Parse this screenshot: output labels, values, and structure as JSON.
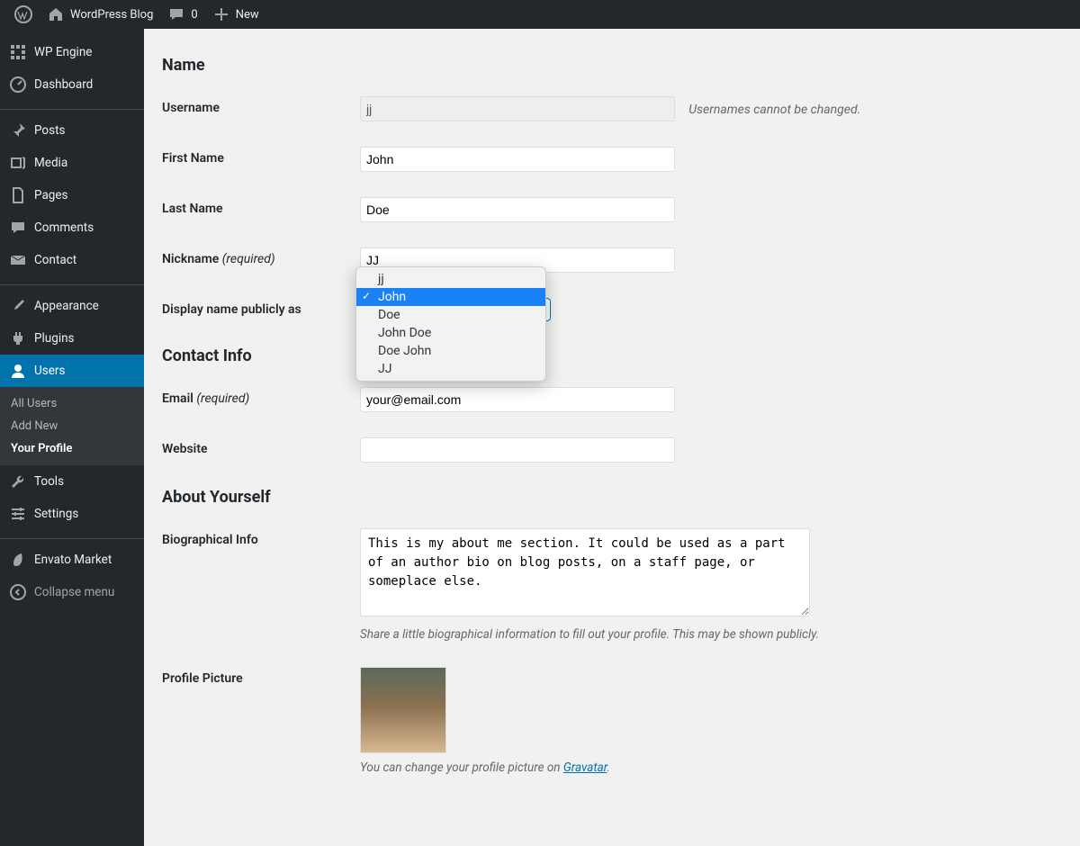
{
  "adminbar": {
    "site_title": "WordPress Blog",
    "comments_count": "0",
    "new_label": "New"
  },
  "sidebar": {
    "items": [
      {
        "label": "WP Engine",
        "icon": "wpengine"
      },
      {
        "label": "Dashboard",
        "icon": "dashboard"
      },
      {
        "label": "Posts",
        "icon": "posts"
      },
      {
        "label": "Media",
        "icon": "media"
      },
      {
        "label": "Pages",
        "icon": "pages"
      },
      {
        "label": "Comments",
        "icon": "comments"
      },
      {
        "label": "Contact",
        "icon": "contact"
      },
      {
        "label": "Appearance",
        "icon": "appearance"
      },
      {
        "label": "Plugins",
        "icon": "plugins"
      },
      {
        "label": "Users",
        "icon": "users",
        "active": true,
        "submenu": [
          {
            "label": "All Users"
          },
          {
            "label": "Add New"
          },
          {
            "label": "Your Profile",
            "active": true
          }
        ]
      },
      {
        "label": "Tools",
        "icon": "tools"
      },
      {
        "label": "Settings",
        "icon": "settings"
      },
      {
        "label": "Envato Market",
        "icon": "envato"
      }
    ],
    "collapse_label": "Collapse menu"
  },
  "sections": {
    "name": {
      "heading": "Name",
      "username_label": "Username",
      "username_value": "jj",
      "username_hint": "Usernames cannot be changed.",
      "firstname_label": "First Name",
      "firstname_value": "John",
      "lastname_label": "Last Name",
      "lastname_value": "Doe",
      "nickname_label": "Nickname ",
      "nickname_req": "(required)",
      "nickname_value": "JJ",
      "display_label": "Display name publicly as",
      "display_selected": "John",
      "display_options": [
        "jj",
        "John",
        "Doe",
        "John Doe",
        "Doe John",
        "JJ"
      ]
    },
    "contact": {
      "heading": "Contact Info",
      "email_label": "Email ",
      "email_req": "(required)",
      "email_value": "your@email.com",
      "website_label": "Website",
      "website_value": ""
    },
    "about": {
      "heading": "About Yourself",
      "bio_label": "Biographical Info",
      "bio_value": "This is my about me section. It could be used as a part of an author bio on blog posts, on a staff page, or someplace else.",
      "bio_hint": "Share a little biographical information to fill out your profile. This may be shown publicly.",
      "picture_label": "Profile Picture",
      "picture_hint_pre": "You can change your profile picture on ",
      "picture_hint_link": "Gravatar",
      "picture_hint_post": "."
    }
  }
}
